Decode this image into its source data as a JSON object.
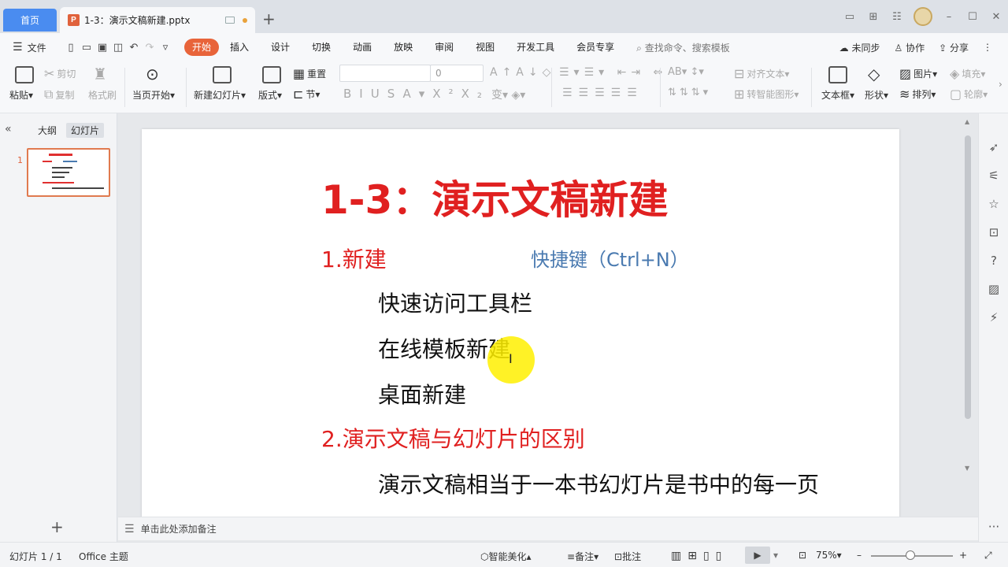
{
  "titlebar": {
    "home_tab": "首页",
    "doc_tab": "1-3：演示文稿新建.pptx",
    "doc_icon_letter": "P",
    "add_tab": "+"
  },
  "menubar": {
    "file": "文件",
    "tabs": [
      "开始",
      "插入",
      "设计",
      "切换",
      "动画",
      "放映",
      "审阅",
      "视图",
      "开发工具",
      "会员专享"
    ],
    "active_tab": "开始",
    "search": "查找命令、搜索模板",
    "sync": "未同步",
    "collab": "协作",
    "share": "分享"
  },
  "ribbon": {
    "paste": "粘贴",
    "cut": "剪切",
    "copy": "复制",
    "format_painter": "格式刷",
    "start_from_current": "当页开始",
    "new_slide": "新建幻灯片",
    "layout": "版式",
    "reset": "重置",
    "section": "节",
    "font_size_value": "0",
    "text_direction": "对齐文本",
    "smart_shape": "转智能图形",
    "text_box": "文本框",
    "shape": "形状",
    "picture": "图片",
    "arrange": "排列",
    "fill": "填充",
    "outline": "轮廓"
  },
  "leftpanel": {
    "outline_tab": "大纲",
    "slides_tab": "幻灯片",
    "slide_number": "1",
    "add": "+"
  },
  "slide": {
    "title": "1-3：演示文稿新建",
    "h1": "1.新建",
    "shortcut": "快捷键（Ctrl+N）",
    "items": [
      "快速访问工具栏",
      "在线模板新建",
      "桌面新建"
    ],
    "h2": "2.演示文稿与幻灯片的区别",
    "last": "演示文稿相当于一本书幻灯片是书中的每一页"
  },
  "notes": {
    "placeholder": "单击此处添加备注"
  },
  "statusbar": {
    "slide_info": "幻灯片 1 / 1",
    "theme": "Office 主题",
    "beautify": "智能美化",
    "notes": "备注",
    "comments": "批注",
    "zoom": "75%"
  },
  "colors": {
    "accent": "#e8643a",
    "home_tab": "#4a8cf0",
    "slide_red": "#e02020",
    "slide_blue": "#4a7ab0"
  }
}
